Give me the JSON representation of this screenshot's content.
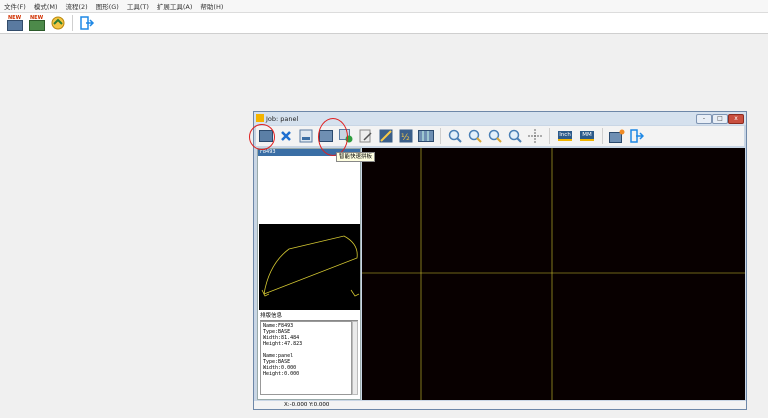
{
  "menu": [
    "文件(F)",
    "模式(M)",
    "流程(2)",
    "图形(G)",
    "工具(T)",
    "扩展工具(A)",
    "帮助(H)"
  ],
  "toolbar": {
    "new1": "NEW",
    "new2": "NEW"
  },
  "job_window": {
    "title": "Job: panel",
    "min": "-",
    "max": "□",
    "close": "x",
    "list_header": "F8493",
    "tooltip": "智能快速拼板",
    "info_title": "排版信息",
    "info_lines": [
      "Name:F8493",
      "Type:BASE",
      "Width:81.484",
      "Height:47.823",
      "",
      "Name:panel",
      "Type:BASE",
      "Width:0.000",
      "Height:0.000"
    ],
    "toolbar_labels": {
      "inch": "Inch",
      "mm": "MM"
    },
    "status": "X:-0.000 Y:0.000"
  }
}
